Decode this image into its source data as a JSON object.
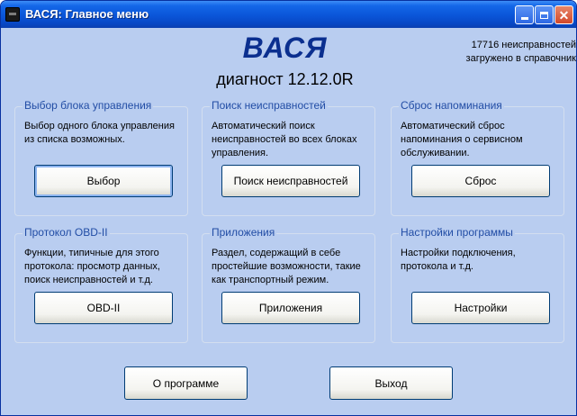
{
  "window": {
    "title": "ВАСЯ:  Главное меню",
    "icon": "app-icon"
  },
  "header": {
    "brand": "ВАСЯ",
    "version": "диагност 12.12.0R",
    "db_info_line1": "17716 неисправностей",
    "db_info_line2": "загружено в справочник"
  },
  "groups": [
    {
      "title": "Выбор блока управления",
      "description": "Выбор одного блока управления из списка возможных.",
      "button": "Выбор"
    },
    {
      "title": "Поиск неисправностей",
      "description": "Автоматический поиск неисправностей во всех блоках управления.",
      "button": "Поиск неисправностей"
    },
    {
      "title": "Сброс напоминания",
      "description": "Автоматический сброс напоминания о сервисном обслуживании.",
      "button": "Сброс"
    },
    {
      "title": "Протокол OBD-II",
      "description": "Функции, типичные для этого протокола: просмотр данных, поиск неисправностей и т.д.",
      "button": "OBD-II"
    },
    {
      "title": "Приложения",
      "description": "Раздел, содержащий в себе простейшие возможности, такие как транспортный режим.",
      "button": "Приложения"
    },
    {
      "title": "Настройки программы",
      "description": "Настройки подключения, протокола и т.д.",
      "button": "Настройки"
    }
  ],
  "footer": {
    "about": "О программе",
    "exit": "Выход"
  },
  "colors": {
    "titlebar": "#0a55d8",
    "client_bg": "#b9cdf0",
    "brand": "#0b2f8f",
    "group_title": "#224da5"
  }
}
